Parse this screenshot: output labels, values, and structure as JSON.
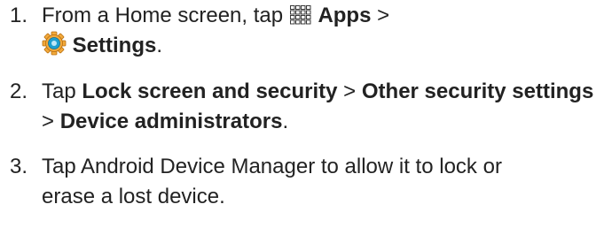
{
  "steps": [
    {
      "number": "1.",
      "intro": "From a Home screen, tap ",
      "apps_icon": "apps-grid-icon",
      "apps_label": "Apps",
      "sep": " >",
      "settings_icon": "settings-gear-icon",
      "settings_label": "Settings",
      "end": "."
    },
    {
      "number": "2.",
      "intro": "Tap ",
      "bold1": "Lock screen and security",
      "sep1": " > ",
      "bold2": "Other security settings",
      "sep2": " > ",
      "bold3": "Device administrators",
      "end": "."
    },
    {
      "number": "3.",
      "line1": "Tap Android Device Manager to allow it to lock or",
      "line2": "erase a lost device."
    }
  ],
  "colors": {
    "text": "#222222",
    "settings_icon_accent": "#1e9fd0"
  }
}
